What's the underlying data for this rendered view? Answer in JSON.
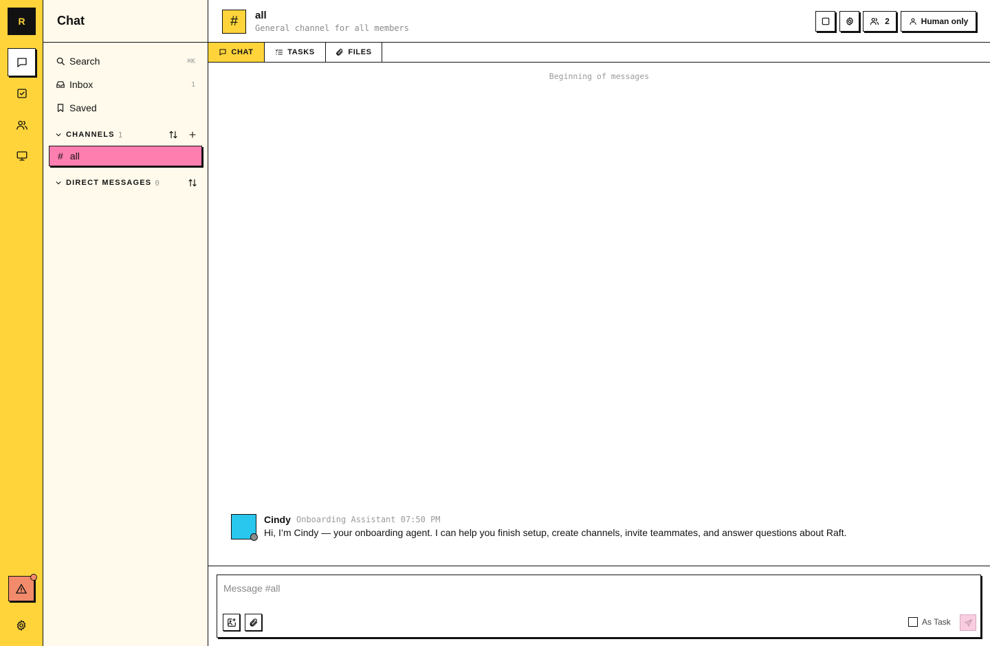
{
  "rail": {
    "logo_letter": "R",
    "items": [
      {
        "icon": "chat-icon",
        "active": true
      },
      {
        "icon": "tasks-icon",
        "active": false
      },
      {
        "icon": "people-icon",
        "active": false
      },
      {
        "icon": "monitor-icon",
        "active": false
      }
    ],
    "alert_icon": "warning-icon",
    "settings_icon": "gear-icon"
  },
  "sidebar": {
    "title": "Chat",
    "search": {
      "label": "Search",
      "shortcut": "⌘K"
    },
    "inbox": {
      "label": "Inbox",
      "count": "1"
    },
    "saved": {
      "label": "Saved"
    },
    "channels": {
      "label": "CHANNELS",
      "count": "1",
      "items": [
        {
          "label": "all",
          "active": true
        }
      ]
    },
    "direct_messages": {
      "label": "DIRECT MESSAGES",
      "count": "0"
    }
  },
  "header": {
    "channel_icon": "#",
    "channel_name": "all",
    "channel_description": "General channel for all members",
    "members_count": "2",
    "mode_label": "Human only"
  },
  "tabs": [
    {
      "label": "CHAT",
      "icon": "chat-icon",
      "active": true
    },
    {
      "label": "TASKS",
      "icon": "list-icon",
      "active": false
    },
    {
      "label": "FILES",
      "icon": "paperclip-icon",
      "active": false
    }
  ],
  "messages_start": "Beginning of messages",
  "messages": [
    {
      "author": "Cindy",
      "role": "Onboarding Assistant",
      "time": "07:50 PM",
      "text": "Hi, I’m Cindy — your onboarding agent. I can help you finish setup, create channels, invite teammates, and answer questions about Raft.",
      "avatar_color": "#29c6ee"
    }
  ],
  "composer": {
    "placeholder": "Message #all",
    "as_task_label": "As Task"
  },
  "colors": {
    "accent_yellow": "#ffd43b",
    "active_channel_pink": "#ff7eb0",
    "alert_orange": "#f28b6b",
    "sidebar_bg": "#fffaeb"
  }
}
